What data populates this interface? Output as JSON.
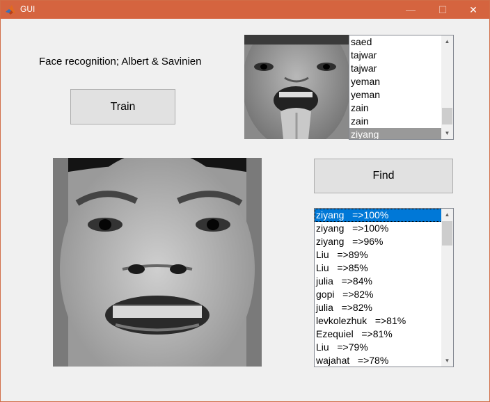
{
  "window": {
    "title": "GUI",
    "minimize_icon": "minimize-icon",
    "maximize_icon": "maximize-icon",
    "close_icon": "close-icon"
  },
  "header_text": "Face recognition; Albert & Savinien",
  "buttons": {
    "train": "Train",
    "find": "Find"
  },
  "database_list": {
    "items": [
      "saed",
      "tajwar",
      "tajwar",
      "yeman",
      "yeman",
      "zain",
      "zain",
      "ziyang"
    ],
    "selected_index": 7
  },
  "results_list": {
    "items": [
      "ziyang   =>100%",
      "ziyang   =>100%",
      "ziyang   =>96%",
      "Liu   =>89%",
      "Liu   =>85%",
      "julia   =>84%",
      "gopi   =>82%",
      "julia   =>82%",
      "levkolezhuk   =>81%",
      "Ezequiel   =>81%",
      "Liu   =>79%",
      "wajahat   =>78%"
    ],
    "selected_index": 0
  },
  "images": {
    "match_face": "matched-face-image",
    "query_face": "query-face-image"
  },
  "colors": {
    "titlebar": "#d5643f",
    "selection_blue": "#0078d7",
    "selection_gray": "#999999"
  }
}
